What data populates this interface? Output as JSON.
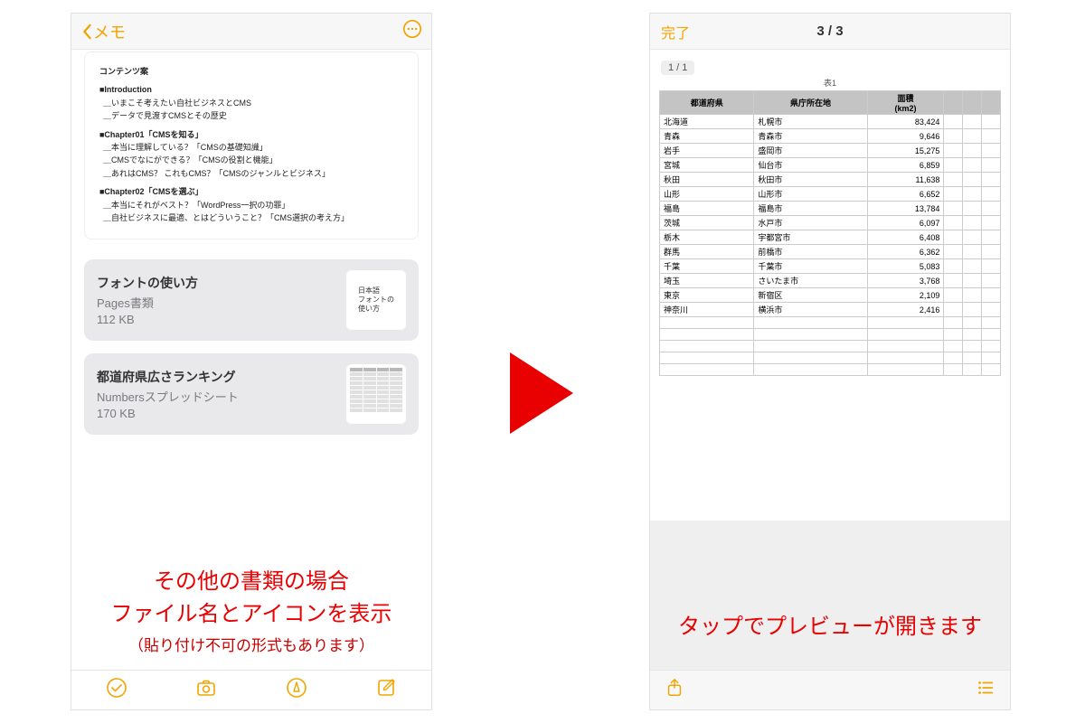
{
  "left": {
    "nav": {
      "back_label": "メモ"
    },
    "note": {
      "heading": "コンテンツ案",
      "sections": [
        {
          "title": "■Introduction",
          "lines": [
            "＿いまこそ考えたい自社ビジネスとCMS",
            "＿データで見渡すCMSとその歴史"
          ]
        },
        {
          "title": "■Chapter01「CMSを知る」",
          "lines": [
            "＿本当に理解している？「CMSの基礎知識」",
            "＿CMSでなにができる？「CMSの役割と機能」",
            "＿あれはCMS？ これもCMS？「CMSのジャンルとビジネス」"
          ]
        },
        {
          "title": "■Chapter02「CMSを選ぶ」",
          "lines": [
            "＿本当にそれがベスト？「WordPress一択の功罪」",
            "＿自社ビジネスに最適、とはどういうこと？「CMS選択の考え方」"
          ]
        }
      ]
    },
    "attachments": [
      {
        "title": "フォントの使い方",
        "subtitle": "Pages書類",
        "size": "112 KB",
        "thumb_text": "日本語\nフォントの\n使い方"
      },
      {
        "title": "都道府県広さランキング",
        "subtitle": "Numbersスプレッドシート",
        "size": "170 KB",
        "thumb_text": ""
      }
    ]
  },
  "right": {
    "nav": {
      "done_label": "完了",
      "page_indicator": "3 / 3"
    },
    "sheet": {
      "page_badge": "1 / 1",
      "title": "表1",
      "headers": [
        "都道府県",
        "県庁所在地",
        "面積\n(km2)",
        "",
        "",
        ""
      ],
      "rows": [
        [
          "北海道",
          "札幌市",
          "83,424"
        ],
        [
          "青森",
          "青森市",
          "9,646"
        ],
        [
          "岩手",
          "盛岡市",
          "15,275"
        ],
        [
          "宮城",
          "仙台市",
          "6,859"
        ],
        [
          "秋田",
          "秋田市",
          "11,638"
        ],
        [
          "山形",
          "山形市",
          "6,652"
        ],
        [
          "福島",
          "福島市",
          "13,784"
        ],
        [
          "茨城",
          "水戸市",
          "6,097"
        ],
        [
          "栃木",
          "宇都宮市",
          "6,408"
        ],
        [
          "群馬",
          "前橋市",
          "6,362"
        ],
        [
          "千葉",
          "千葉市",
          "5,083"
        ],
        [
          "埼玉",
          "さいたま市",
          "3,768"
        ],
        [
          "東京",
          "新宿区",
          "2,109"
        ],
        [
          "神奈川",
          "横浜市",
          "2,416"
        ]
      ],
      "empty_rows": 5
    }
  },
  "captions": {
    "left_line1": "その他の書類の場合",
    "left_line2": "ファイル名とアイコンを表示",
    "left_sub": "（貼り付け不可の形式もあります）",
    "right": "タップでプレビューが開きます"
  }
}
